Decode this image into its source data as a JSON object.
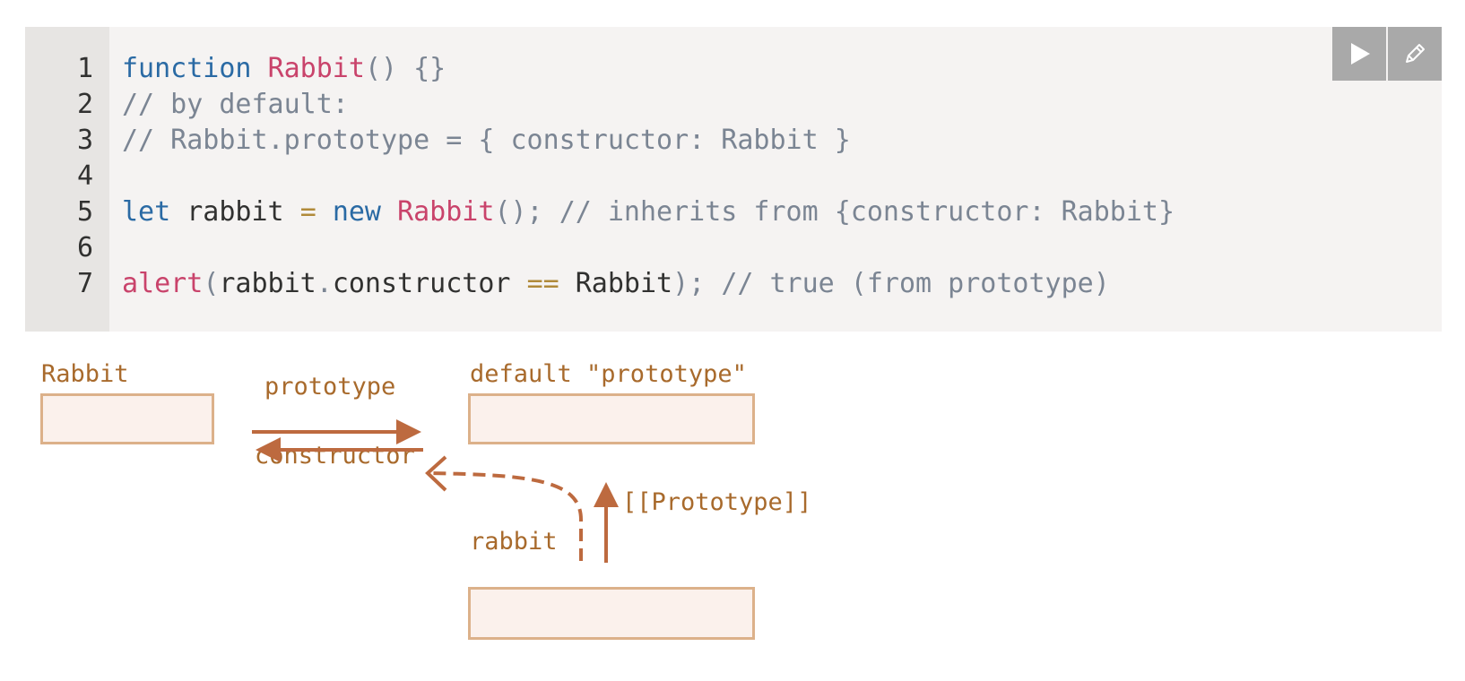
{
  "code": {
    "lines": [
      {
        "num": "1",
        "tokens": [
          {
            "t": "function",
            "c": "kw"
          },
          {
            "t": " ",
            "c": "id"
          },
          {
            "t": "Rabbit",
            "c": "fn"
          },
          {
            "t": "() {}",
            "c": "pn"
          }
        ]
      },
      {
        "num": "2",
        "tokens": [
          {
            "t": "// by default:",
            "c": "cm"
          }
        ]
      },
      {
        "num": "3",
        "tokens": [
          {
            "t": "// Rabbit.prototype = { constructor: Rabbit }",
            "c": "cm"
          }
        ]
      },
      {
        "num": "4",
        "tokens": []
      },
      {
        "num": "5",
        "tokens": [
          {
            "t": "let",
            "c": "kw"
          },
          {
            "t": " rabbit ",
            "c": "id"
          },
          {
            "t": "=",
            "c": "op"
          },
          {
            "t": " ",
            "c": "id"
          },
          {
            "t": "new",
            "c": "kw"
          },
          {
            "t": " ",
            "c": "id"
          },
          {
            "t": "Rabbit",
            "c": "fn"
          },
          {
            "t": "();",
            "c": "pn"
          },
          {
            "t": " ",
            "c": "id"
          },
          {
            "t": "// inherits from {constructor: Rabbit}",
            "c": "cm"
          }
        ]
      },
      {
        "num": "6",
        "tokens": []
      },
      {
        "num": "7",
        "tokens": [
          {
            "t": "alert",
            "c": "fn"
          },
          {
            "t": "(",
            "c": "pn"
          },
          {
            "t": "rabbit",
            "c": "id"
          },
          {
            "t": ".",
            "c": "pn"
          },
          {
            "t": "constructor ",
            "c": "id"
          },
          {
            "t": "==",
            "c": "op"
          },
          {
            "t": " Rabbit",
            "c": "id"
          },
          {
            "t": ");",
            "c": "pn"
          },
          {
            "t": " ",
            "c": "id"
          },
          {
            "t": "// true (from prototype)",
            "c": "cm"
          }
        ]
      }
    ],
    "run_icon": "play-icon",
    "edit_icon": "pencil-icon"
  },
  "diagram": {
    "rabbit_func_label": "Rabbit",
    "prototype_arrow_label": "prototype",
    "default_prototype_label": "default \"prototype\"",
    "constructor_arrow_label": "constructor",
    "proto_link_label": "[[Prototype]]",
    "rabbit_obj_label": "rabbit"
  },
  "colors": {
    "diagram_text": "#a86a2c",
    "arrow": "#bd6a3f",
    "box_fill": "#fbf1ec",
    "box_border": "#dcb18a",
    "code_bg": "#f5f3f2",
    "gutter_bg": "#e7e5e3",
    "button_bg": "#a9a9a9"
  }
}
